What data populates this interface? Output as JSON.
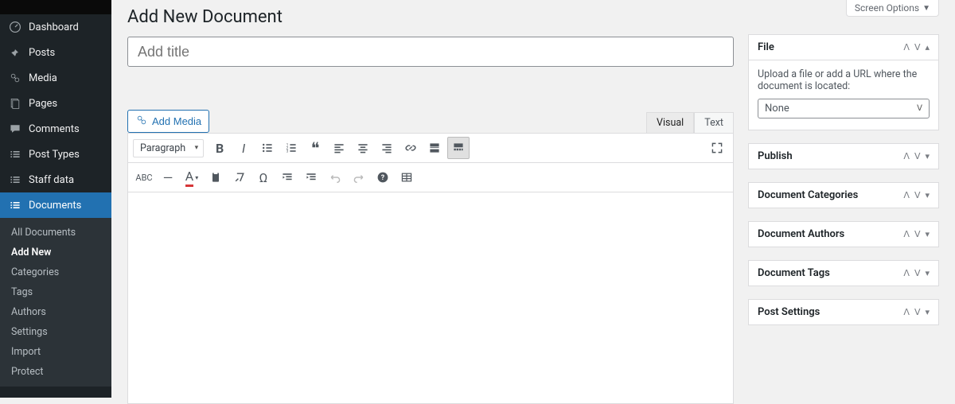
{
  "screen_options": "Screen Options",
  "page_title": "Add New Document",
  "title_placeholder": "Add title",
  "sidebar": {
    "items": [
      {
        "label": "Dashboard",
        "icon": "dashboard"
      },
      {
        "label": "Posts",
        "icon": "pin"
      },
      {
        "label": "Media",
        "icon": "media"
      },
      {
        "label": "Pages",
        "icon": "page"
      },
      {
        "label": "Comments",
        "icon": "comment"
      },
      {
        "label": "Post Types",
        "icon": "list"
      },
      {
        "label": "Staff data",
        "icon": "list"
      },
      {
        "label": "Documents",
        "icon": "list",
        "current": true
      }
    ],
    "sub": [
      {
        "label": "All Documents"
      },
      {
        "label": "Add New",
        "current": true
      },
      {
        "label": "Categories"
      },
      {
        "label": "Tags"
      },
      {
        "label": "Authors"
      },
      {
        "label": "Settings"
      },
      {
        "label": "Import"
      },
      {
        "label": "Protect"
      }
    ]
  },
  "editor": {
    "add_media": "Add Media",
    "tabs": {
      "visual": "Visual",
      "text": "Text"
    },
    "format_select": "Paragraph"
  },
  "file_panel": {
    "title": "File",
    "desc": "Upload a file or add a URL where the document is located:",
    "select_value": "None"
  },
  "panels": [
    {
      "title": "Publish"
    },
    {
      "title": "Document Categories"
    },
    {
      "title": "Document Authors"
    },
    {
      "title": "Document Tags"
    },
    {
      "title": "Post Settings"
    }
  ]
}
